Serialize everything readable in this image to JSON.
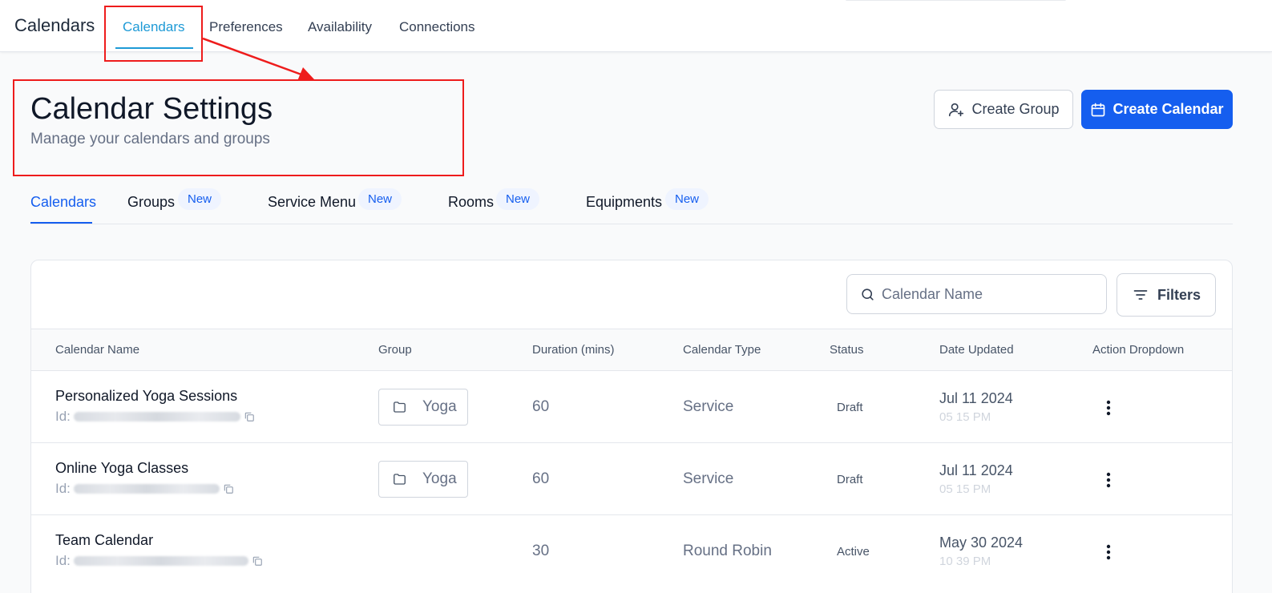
{
  "topnav": {
    "app_title": "Calendars",
    "tabs": [
      {
        "label": "Calendars",
        "active": true
      },
      {
        "label": "Preferences",
        "active": false
      },
      {
        "label": "Availability",
        "active": false
      },
      {
        "label": "Connections",
        "active": false
      }
    ]
  },
  "header": {
    "title": "Calendar Settings",
    "subtitle": "Manage your calendars and groups",
    "create_group_label": "Create Group",
    "create_calendar_label": "Create Calendar"
  },
  "subtabs": [
    {
      "label": "Calendars",
      "active": true,
      "badge": ""
    },
    {
      "label": "Groups",
      "active": false,
      "badge": "New"
    },
    {
      "label": "Service Menu",
      "active": false,
      "badge": "New"
    },
    {
      "label": "Rooms",
      "active": false,
      "badge": "New"
    },
    {
      "label": "Equipments",
      "active": false,
      "badge": "New"
    }
  ],
  "toolbar": {
    "search_placeholder": "Calendar Name",
    "filters_label": "Filters"
  },
  "table": {
    "columns": [
      "Calendar Name",
      "Group",
      "Duration (mins)",
      "Calendar Type",
      "Status",
      "Date Updated",
      "Action Dropdown"
    ],
    "id_label": "Id:",
    "rows": [
      {
        "name": "Personalized Yoga Sessions",
        "group": "Yoga",
        "duration": "60",
        "type": "Service",
        "status": "Draft",
        "date": "Jul 11 2024",
        "time": "05 15 PM"
      },
      {
        "name": "Online Yoga Classes",
        "group": "Yoga",
        "duration": "60",
        "type": "Service",
        "status": "Draft",
        "date": "Jul 11 2024",
        "time": "05 15 PM"
      },
      {
        "name": "Team Calendar",
        "group": "",
        "duration": "30",
        "type": "Round Robin",
        "status": "Active",
        "date": "May 30 2024",
        "time": "10 39 PM"
      }
    ]
  },
  "colors": {
    "primary": "#155eef",
    "active_top_tab": "#1e9ad6",
    "annotation": "#ee1c1c"
  },
  "icons": [
    "user-plus-icon",
    "calendar-icon",
    "search-icon",
    "filter-lines-icon",
    "folder-icon",
    "copy-icon",
    "kebab-menu-icon"
  ]
}
